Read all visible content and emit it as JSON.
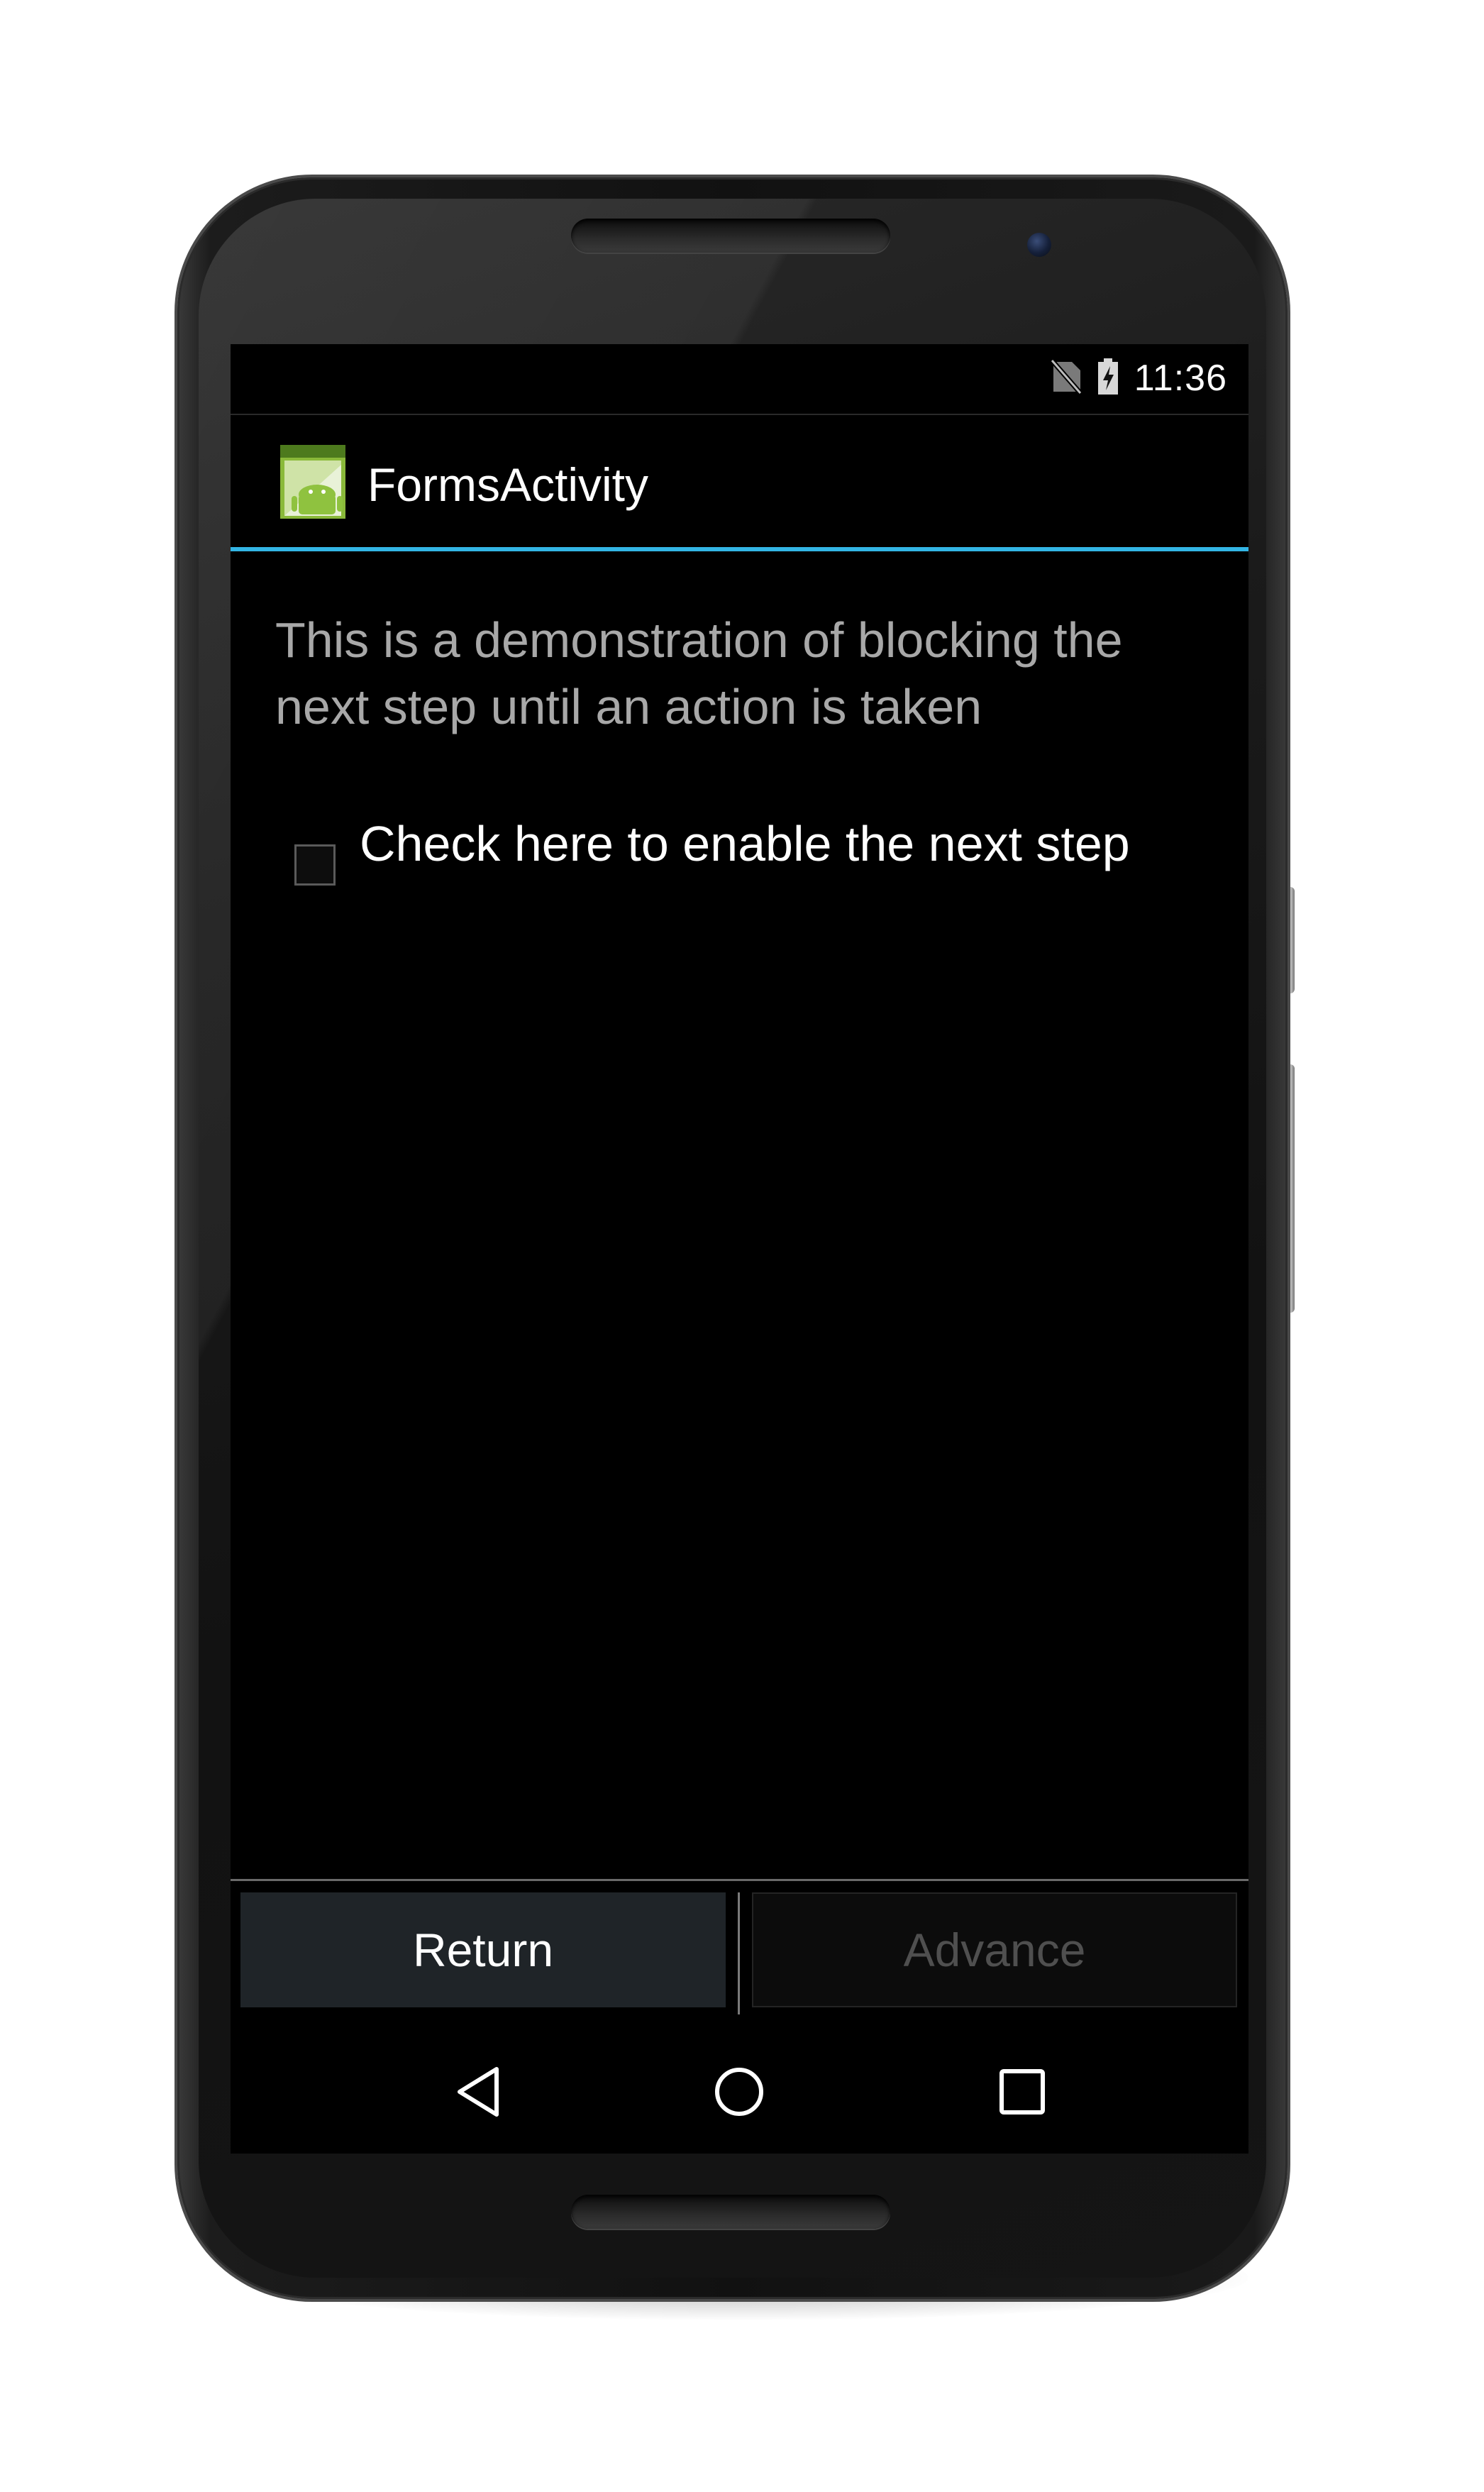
{
  "status_bar": {
    "time": "11:36",
    "icons": [
      "no-sim-icon",
      "battery-charging-icon"
    ]
  },
  "action_bar": {
    "app_icon": "android-app-icon",
    "title": "FormsActivity"
  },
  "content": {
    "description": "This is a demonstration of blocking the next step until an action is taken",
    "checkbox": {
      "label": "Check here to enable the next step",
      "checked": false
    }
  },
  "buttons": {
    "return_label": "Return",
    "advance_label": "Advance",
    "advance_enabled": false
  },
  "nav_bar": {
    "icons": [
      "back-icon",
      "home-icon",
      "recents-icon"
    ]
  },
  "colors": {
    "accent": "#33b5e5",
    "background": "#000000",
    "return_button_bg": "#1f2428",
    "disabled_text": "#4f4f4f"
  }
}
